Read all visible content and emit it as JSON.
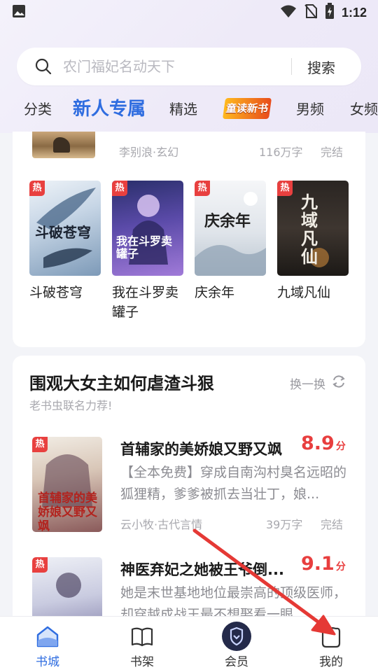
{
  "status_bar": {
    "time": "1:12",
    "icons": [
      "image-icon",
      "wifi-icon",
      "no-sim-icon",
      "battery-charging-icon"
    ]
  },
  "search": {
    "placeholder": "农门福妃名动天下",
    "button_label": "搜索"
  },
  "tabs": [
    {
      "label": "分类"
    },
    {
      "label": "新人专属",
      "active": true
    },
    {
      "label": "精选"
    },
    {
      "label": "童读新书",
      "special": true
    },
    {
      "label": "男频"
    },
    {
      "label": "女频"
    }
  ],
  "card1": {
    "partial_book": {
      "meta": "李别浪·玄幻",
      "words": "116万字",
      "status": "完结"
    },
    "books": [
      {
        "name": "斗破苍穹",
        "badge": "热",
        "cover_text": "斗破苍穹"
      },
      {
        "name": "我在斗罗卖罐子",
        "badge": "热",
        "cover_text": "我在斗罗卖罐子"
      },
      {
        "name": "庆余年",
        "badge": "热",
        "cover_text": "庆余年"
      },
      {
        "name": "九域凡仙",
        "badge": "热",
        "cover_text": "九域凡仙"
      }
    ]
  },
  "card2": {
    "title": "围观大女主如何虐渣斗狠",
    "subtitle": "老书虫联名力荐!",
    "refresh_label": "换一换",
    "books": [
      {
        "title": "首辅家的美娇娘又野又飒",
        "score": "8.9",
        "score_unit": "分",
        "badge": "热",
        "desc": "【全本免费】穿成自南沟村臭名远昭的狐狸精，爹爹被抓去当壮丁，娘...",
        "meta": "云小牧·古代言情",
        "words": "39万字",
        "status": "完结"
      },
      {
        "title": "神医弃妃之她被王爷倒...",
        "score": "9.1",
        "score_unit": "分",
        "badge": "热",
        "desc": "她是末世基地地位最崇高的顶级医师，却穿越成战王最不想娶看一眼",
        "meta": "",
        "words": "",
        "status": ""
      }
    ]
  },
  "bottom_nav": [
    {
      "label": "书城",
      "icon": "bookstore-icon",
      "active": true
    },
    {
      "label": "书架",
      "icon": "bookshelf-icon"
    },
    {
      "label": "会员",
      "icon": "vip-shield-icon"
    },
    {
      "label": "我的",
      "icon": "profile-icon"
    }
  ],
  "colors": {
    "accent": "#2f6de0",
    "hot": "#e8403f",
    "score": "#e83e3e",
    "arrow": "#e53935"
  }
}
